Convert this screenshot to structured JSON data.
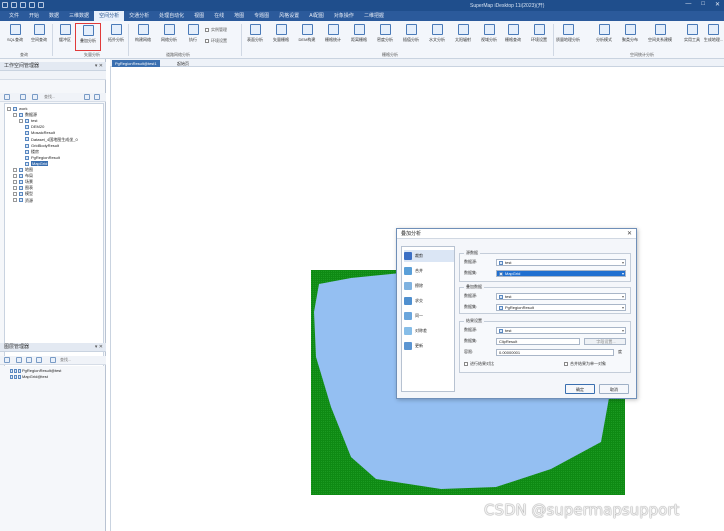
{
  "titlebar": {
    "title": "SuperMap iDesktop 11i(2023)(开)",
    "window_buttons": [
      "—",
      "□",
      "✕"
    ]
  },
  "menu": {
    "tabs": [
      "文件",
      "开始",
      "数据",
      "三维数据",
      "空间分析",
      "交通分析",
      "处理自动化",
      "视图",
      "在线",
      "地图",
      "专题图",
      "风格设置",
      "AI配图",
      "对象操作",
      "二维把握"
    ],
    "active_index": 4
  },
  "ribbon": {
    "buttons": [
      "SQL查询",
      "空间查询",
      "缓冲区",
      "叠加分析",
      "拓扑分析",
      "构建网络",
      "网络分析",
      "执行",
      "表面分析",
      "矢量栅格",
      "DEM构建",
      "栅格统计",
      "距离栅格",
      "密度分析",
      "插值分析",
      "水文分析",
      "太阳辐射",
      "视域分析",
      "栅格查询",
      "环境设置",
      "质量地理分析",
      "分析模式",
      "聚类分布",
      "空间关系建模",
      "实用工具",
      "生成地理..."
    ],
    "small_items": [
      "实例管理",
      "环境设置"
    ],
    "groups": [
      "查询",
      "矢量分析",
      "道路网络分析",
      "栅格分析",
      "空间统计分析"
    ]
  },
  "doctabs": [
    "PgRegionResult@test1",
    "起始页"
  ],
  "workspace_panel": {
    "title": "工作空间管理器",
    "search_placeholder": "查找...",
    "tree": [
      {
        "label": "work",
        "level": 0
      },
      {
        "label": "数据源",
        "level": 1
      },
      {
        "label": "test",
        "level": 2
      },
      {
        "label": "DEM20",
        "level": 3
      },
      {
        "label": "MosaicResult",
        "level": 3
      },
      {
        "label": "Dataset_4国地图生成坐_0",
        "level": 3
      },
      {
        "label": "GridBodyResult",
        "level": 3
      },
      {
        "label": "楼房",
        "level": 3
      },
      {
        "label": "PgRegionResult",
        "level": 3
      },
      {
        "label": "MapGrid",
        "level": 3,
        "selected": true
      },
      {
        "label": "地图",
        "level": 1
      },
      {
        "label": "布局",
        "level": 1
      },
      {
        "label": "场景",
        "level": 1
      },
      {
        "label": "图表",
        "level": 1
      },
      {
        "label": "模型",
        "level": 1
      },
      {
        "label": "资源",
        "level": 1
      }
    ]
  },
  "layer_panel": {
    "title": "图层管理器",
    "search_placeholder": "查找...",
    "layers": [
      "PgRegionResult@test",
      "MapGrid@test"
    ]
  },
  "dialog": {
    "title": "叠加分析",
    "close": "✕",
    "methods": [
      {
        "label": "裁剪",
        "color": "#3b6fc4",
        "selected": true
      },
      {
        "label": "合并",
        "color": "#5a9fd8"
      },
      {
        "label": "擦除",
        "color": "#7fb2e0"
      },
      {
        "label": "求交",
        "color": "#4f8fcf"
      },
      {
        "label": "同一",
        "color": "#6aa5dc"
      },
      {
        "label": "对称差",
        "color": "#86bde8"
      },
      {
        "label": "更新",
        "color": "#5b95d2"
      }
    ],
    "source": {
      "group_label": "源数据",
      "datasource_label": "数据源:",
      "datasource_value": "test",
      "dataset_label": "数据集:",
      "dataset_value": "MapGrid"
    },
    "overlay": {
      "group_label": "叠加数据",
      "datasource_label": "数据源:",
      "datasource_value": "test",
      "dataset_label": "数据集:",
      "dataset_value": "PgRegionResult"
    },
    "result": {
      "group_label": "结果设置",
      "datasource_label": "数据源:",
      "datasource_value": "test",
      "dataset_label": "数据集:",
      "dataset_value": "ClipResult",
      "field_button": "字段设置...",
      "tolerance_label": "容限:",
      "tolerance_value": "0.00000001",
      "tolerance_unit": "度",
      "check_result_compare": "进行结果对比",
      "check_merge": "合并结果为单一对象"
    },
    "ok_label": "确定",
    "cancel_label": "取消"
  },
  "map": {
    "colors": {
      "background": "#ffffff",
      "grid": "#0f8a14",
      "region": "#94bff2"
    }
  },
  "watermark": "CSDN @supermapsupport",
  "colors": {
    "title_bar": "#1f4e8c",
    "menu_bar": "#2b5a9b",
    "highlight_box": "#e03a3a",
    "selection": "#3a6fb0"
  }
}
